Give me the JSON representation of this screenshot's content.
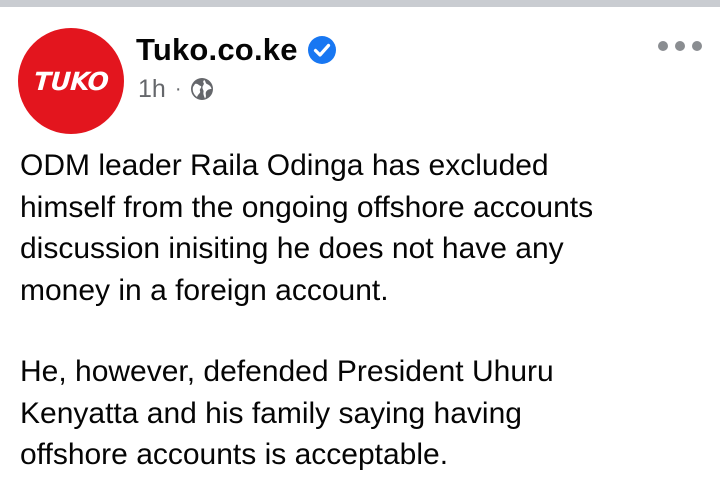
{
  "post": {
    "avatar_text": "TUKO",
    "page_name": "Tuko.co.ke",
    "time_ago": "1h",
    "separator": "·",
    "icons": {
      "verified": "verified-badge-icon",
      "audience": "globe-icon",
      "more": "more-options-icon"
    },
    "paragraphs": [
      "ODM leader Raila Odinga has excluded\nhimself from the ongoing offshore accounts\ndiscussion inisiting he does not have any\nmoney in a foreign account.",
      "He, however, defended President Uhuru\nKenyatta and his family saying having\noffshore accounts is acceptable."
    ]
  },
  "colors": {
    "brand_red": "#e3151e",
    "verified_blue": "#1877f2",
    "meta_gray": "#65676b",
    "text": "#050505"
  }
}
